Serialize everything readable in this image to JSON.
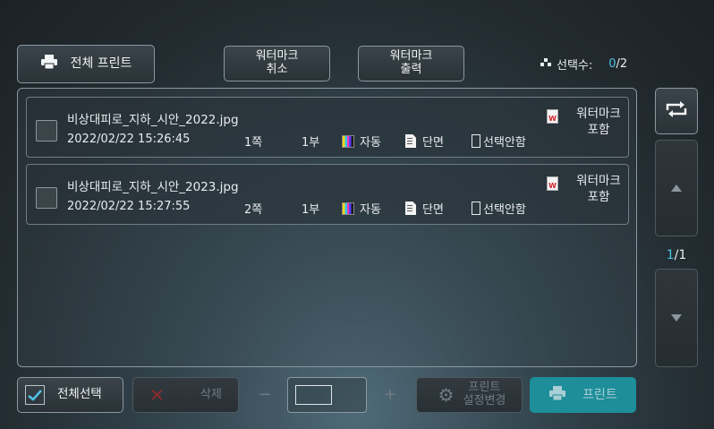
{
  "toolbar": {
    "print_all": "전체 프린트",
    "wm_cancel": [
      "워터마크",
      "취소"
    ],
    "wm_print": [
      "워터마크",
      "출력"
    ],
    "selection_label": "선택수:",
    "selection_count": "0",
    "selection_total": "/2"
  },
  "files": [
    {
      "name": "비상대피로_지하_시안_2022.jpg",
      "datetime": "2022/02/22 15:26:45",
      "pages": "1쪽",
      "copies": "1부",
      "color": "자동",
      "sides": "단면",
      "staple": "선택안함",
      "watermark": [
        "워터마크",
        "포함"
      ],
      "checked": false
    },
    {
      "name": "비상대피로_지하_시안_2023.jpg",
      "datetime": "2022/02/22 15:27:55",
      "pages": "2쪽",
      "copies": "1부",
      "color": "자동",
      "sides": "단면",
      "staple": "선택안함",
      "watermark": [
        "워터마크",
        "포함"
      ],
      "checked": false
    }
  ],
  "pager": {
    "current": "1",
    "total": "/1"
  },
  "bottom": {
    "select_all": "전체선택",
    "delete": "삭제",
    "minus": "−",
    "plus": "+",
    "settings": [
      "프린트",
      "설정변경"
    ],
    "print": "프린트"
  },
  "colors": {
    "accent": "#4fc3e8",
    "print_button": "#1d8e9a",
    "delete_icon": "#8d2a2e"
  },
  "icons": [
    "printer-icon",
    "sort-icon",
    "refresh-cycle-icon",
    "color-icon",
    "single-side-icon",
    "staple-icon",
    "watermark-doc-icon",
    "check-icon",
    "x-icon",
    "gear-icon",
    "arrow-up-icon",
    "arrow-down-icon"
  ]
}
